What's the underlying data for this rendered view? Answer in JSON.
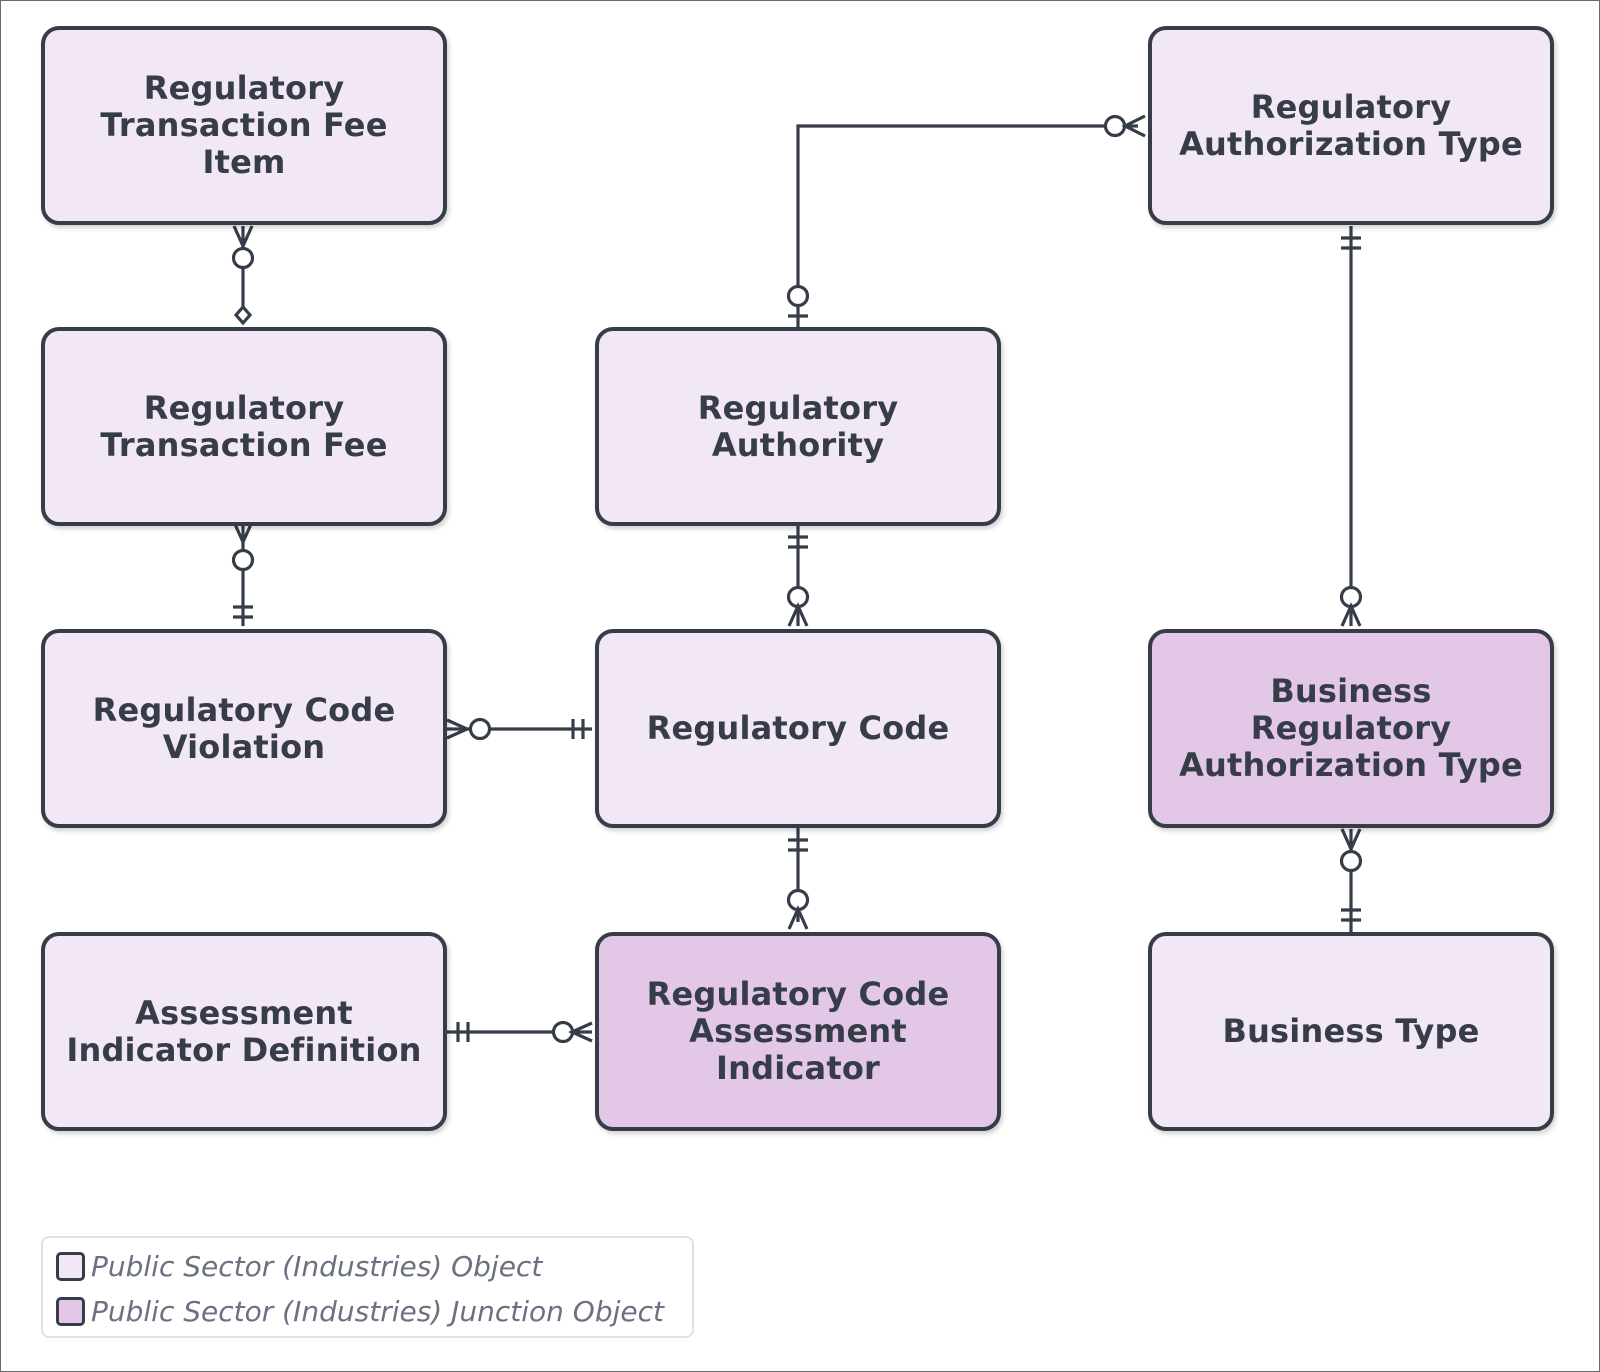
{
  "diagram": {
    "type": "entity-relationship",
    "colors": {
      "object_fill": "#f2e7f4",
      "junction_fill": "#e2c8e6",
      "border": "#363d48",
      "text": "#363d48",
      "legend_text": "#6b7180"
    },
    "entities": [
      {
        "id": "rtfi",
        "label": "Regulatory Transaction Fee Item",
        "kind": "object"
      },
      {
        "id": "rtf",
        "label": "Regulatory Transaction Fee",
        "kind": "object"
      },
      {
        "id": "rcv",
        "label": "Regulatory Code Violation",
        "kind": "object"
      },
      {
        "id": "aid",
        "label": "Assessment Indicator Definition",
        "kind": "object"
      },
      {
        "id": "ra",
        "label": "Regulatory Authority",
        "kind": "object"
      },
      {
        "id": "rc",
        "label": "Regulatory Code",
        "kind": "object"
      },
      {
        "id": "rcai",
        "label": "Regulatory Code Assessment Indicator",
        "kind": "junction"
      },
      {
        "id": "rat",
        "label": "Regulatory Authorization Type",
        "kind": "object"
      },
      {
        "id": "brat",
        "label": "Business Regulatory Authorization Type",
        "kind": "junction"
      },
      {
        "id": "bt",
        "label": "Business Type",
        "kind": "object"
      }
    ],
    "relationships": [
      {
        "from": "rtfi",
        "from_end": "zero-or-many",
        "to": "rtf",
        "to_end": "diamond"
      },
      {
        "from": "rtf",
        "from_end": "zero-or-many",
        "to": "rcv",
        "to_end": "exactly-one"
      },
      {
        "from": "rcv",
        "from_end": "zero-or-many",
        "to": "rc",
        "to_end": "exactly-one"
      },
      {
        "from": "aid",
        "from_end": "exactly-one",
        "to": "rcai",
        "to_end": "zero-or-many"
      },
      {
        "from": "ra",
        "from_end": "zero-or-one",
        "to": "rat",
        "to_end": "zero-or-many"
      },
      {
        "from": "ra",
        "from_end": "exactly-one",
        "to": "rc",
        "to_end": "zero-or-many"
      },
      {
        "from": "rc",
        "from_end": "exactly-one",
        "to": "rcai",
        "to_end": "zero-or-many"
      },
      {
        "from": "rat",
        "from_end": "exactly-one",
        "to": "brat",
        "to_end": "zero-or-many"
      },
      {
        "from": "brat",
        "from_end": "zero-or-many",
        "to": "bt",
        "to_end": "exactly-one"
      }
    ]
  },
  "legend": {
    "items": [
      {
        "label": "Public Sector (Industries) Object",
        "color": "#f2e7f4"
      },
      {
        "label": "Public Sector (Industries) Junction Object",
        "color": "#e2c8e6"
      }
    ]
  }
}
